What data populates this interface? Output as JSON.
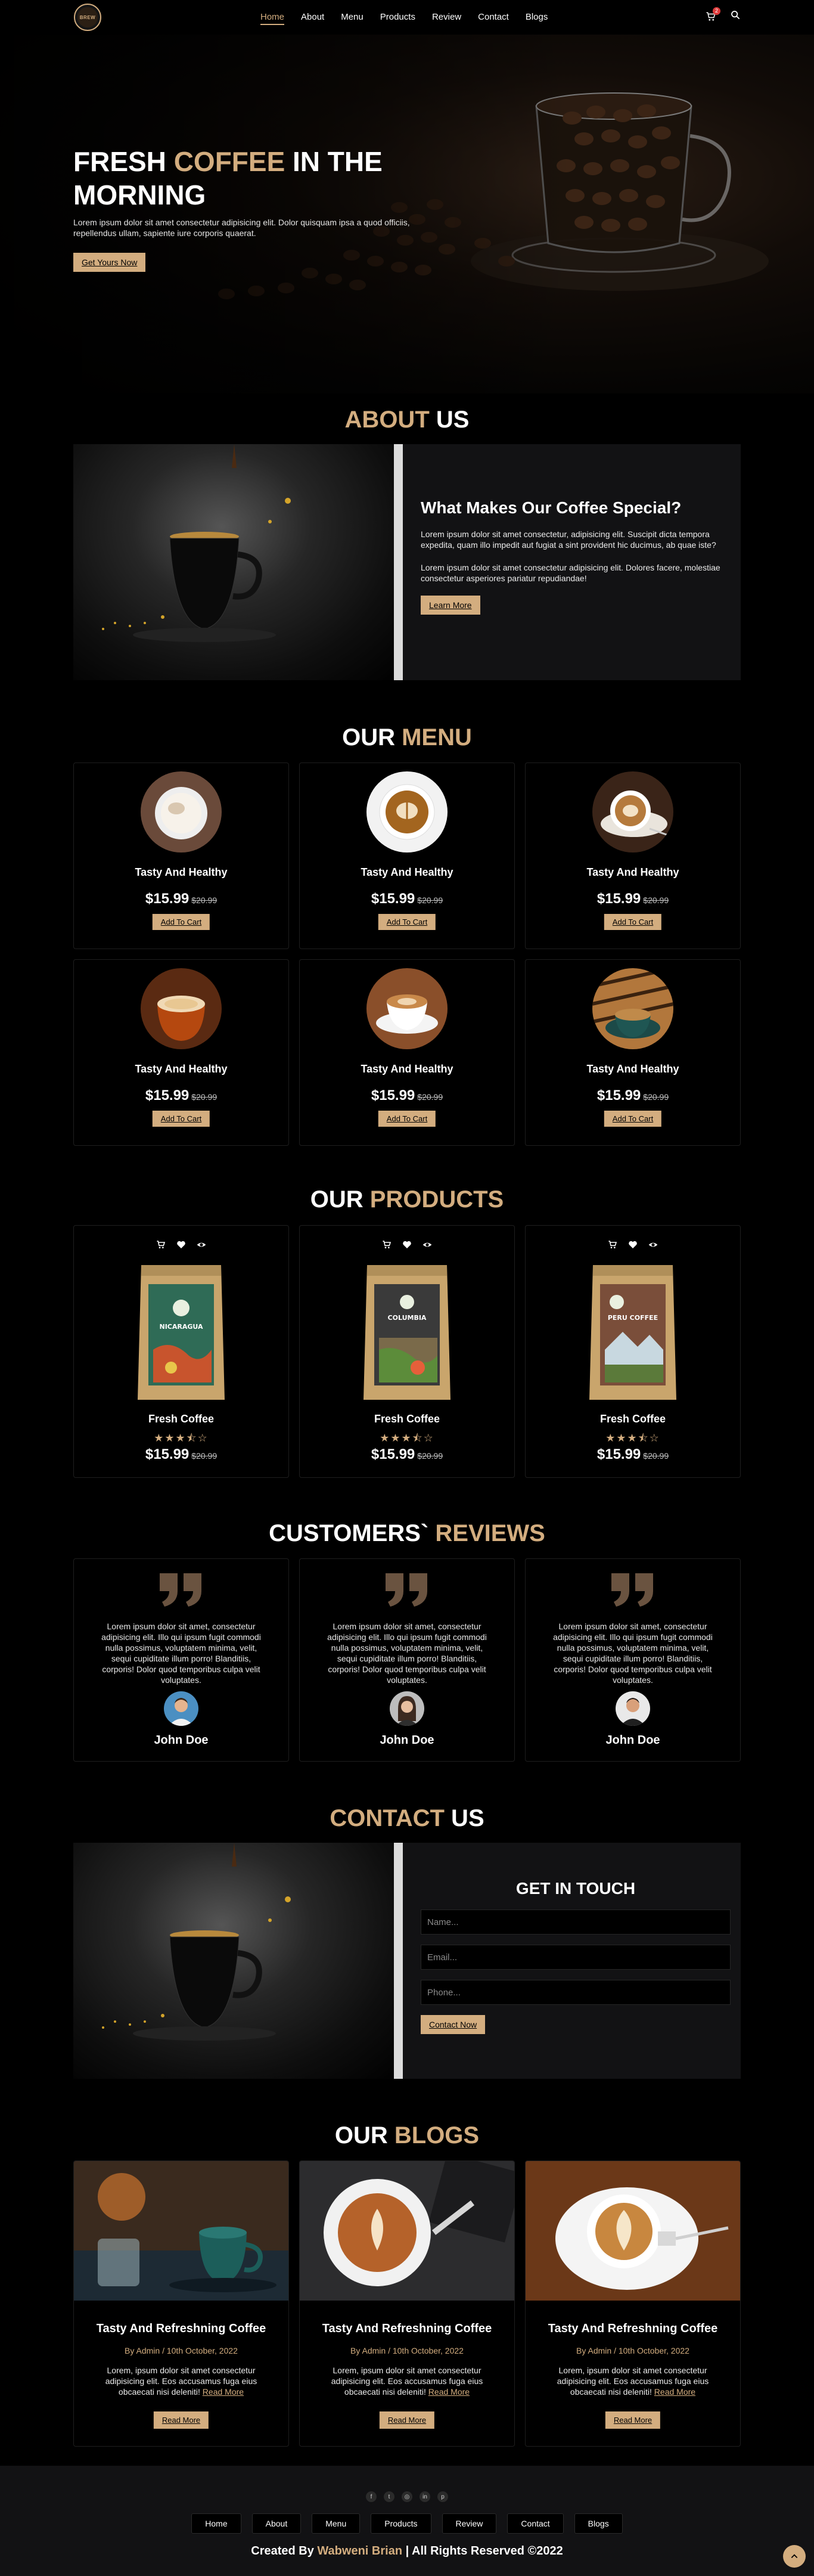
{
  "header": {
    "logo_text": "BREW",
    "nav": [
      "Home",
      "About",
      "Menu",
      "Products",
      "Review",
      "Contact",
      "Blogs"
    ],
    "active_nav": "Home",
    "cart_count": "2"
  },
  "hero": {
    "title_1": "FRESH ",
    "title_accent": "COFFEE",
    "title_2": " IN THE MORNING",
    "text": "Lorem ipsum dolor sit amet consectetur adipisicing elit. Dolor quisquam ipsa a quod officiis, repellendus ullam, sapiente iure corporis quaerat.",
    "button": "Get Yours Now"
  },
  "about": {
    "title_accent": "ABOUT",
    "title_rest": " US",
    "heading": "What Makes Our Coffee Special?",
    "para1": "Lorem ipsum dolor sit amet consectetur, adipisicing elit. Suscipit dicta tempora expedita, quam illo impedit aut fugiat a sint provident hic ducimus, ab quae iste?",
    "para2": "Lorem ipsum dolor sit amet consectetur adipisicing elit. Dolores facere, molestiae consectetur asperiores pariatur repudiandae!",
    "button": "Learn More"
  },
  "menu": {
    "title_main": "OUR ",
    "title_accent": "MENU",
    "items": [
      {
        "name": "Tasty And Healthy",
        "price": "$15.99",
        "old": "$20.99",
        "button": "Add To Cart"
      },
      {
        "name": "Tasty And Healthy",
        "price": "$15.99",
        "old": "$20.99",
        "button": "Add To Cart"
      },
      {
        "name": "Tasty And Healthy",
        "price": "$15.99",
        "old": "$20.99",
        "button": "Add To Cart"
      },
      {
        "name": "Tasty And Healthy",
        "price": "$15.99",
        "old": "$20.99",
        "button": "Add To Cart"
      },
      {
        "name": "Tasty And Healthy",
        "price": "$15.99",
        "old": "$20.99",
        "button": "Add To Cart"
      },
      {
        "name": "Tasty And Healthy",
        "price": "$15.99",
        "old": "$20.99",
        "button": "Add To Cart"
      }
    ]
  },
  "products": {
    "title_main": "OUR ",
    "title_accent": "PRODUCTS",
    "items": [
      {
        "name": "Fresh Coffee",
        "price": "$15.99",
        "old": "$20.99",
        "rating": 3.5,
        "bag_label": "NICARAGUA",
        "bag_color": "#2f6b56"
      },
      {
        "name": "Fresh Coffee",
        "price": "$15.99",
        "old": "$20.99",
        "rating": 3.5,
        "bag_label": "COLUMBIA",
        "bag_color": "#3a3a3a"
      },
      {
        "name": "Fresh Coffee",
        "price": "$15.99",
        "old": "$20.99",
        "rating": 3.5,
        "bag_label": "PERU COFFEE",
        "bag_color": "#7a4e3a"
      }
    ]
  },
  "reviews": {
    "title_main": "CUSTOMERS` ",
    "title_accent": "REVIEWS",
    "items": [
      {
        "text": "Lorem ipsum dolor sit amet, consectetur adipisicing elit. Illo qui ipsum fugit commodi nulla possimus, voluptatem minima, velit, sequi cupiditate illum porro! Blanditiis, corporis! Dolor quod temporibus culpa velit voluptates.",
        "name": "John Doe"
      },
      {
        "text": "Lorem ipsum dolor sit amet, consectetur adipisicing elit. Illo qui ipsum fugit commodi nulla possimus, voluptatem minima, velit, sequi cupiditate illum porro! Blanditiis, corporis! Dolor quod temporibus culpa velit voluptates.",
        "name": "John Doe"
      },
      {
        "text": "Lorem ipsum dolor sit amet, consectetur adipisicing elit. Illo qui ipsum fugit commodi nulla possimus, voluptatem minima, velit, sequi cupiditate illum porro! Blanditiis, corporis! Dolor quod temporibus culpa velit voluptates.",
        "name": "John Doe"
      }
    ]
  },
  "contact": {
    "title_accent": "CONTACT",
    "title_rest": " US",
    "heading": "GET IN TOUCH",
    "name_placeholder": "Name...",
    "email_placeholder": "Email...",
    "phone_placeholder": "Phone...",
    "button": "Contact Now"
  },
  "blogs": {
    "title_main": "OUR ",
    "title_accent": "BLOGS",
    "items": [
      {
        "title": "Tasty And Refreshning Coffee",
        "meta": "By Admin / 10th October, 2022",
        "text": "Lorem, ipsum dolor sit amet consectetur adipisicing elit. Eos accusamus fuga eius obcaecati nisi deleniti! ",
        "read_more": "Read More",
        "button": "Read More"
      },
      {
        "title": "Tasty And Refreshning Coffee",
        "meta": "By Admin / 10th October, 2022",
        "text": "Lorem, ipsum dolor sit amet consectetur adipisicing elit. Eos accusamus fuga eius obcaecati nisi deleniti! ",
        "read_more": "Read More",
        "button": "Read More"
      },
      {
        "title": "Tasty And Refreshning Coffee",
        "meta": "By Admin / 10th October, 2022",
        "text": "Lorem, ipsum dolor sit amet consectetur adipisicing elit. Eos accusamus fuga eius obcaecati nisi deleniti! ",
        "read_more": "Read More",
        "button": "Read More"
      }
    ]
  },
  "footer": {
    "socials": [
      "facebook-icon",
      "twitter-icon",
      "instagram-icon",
      "linkedin-icon",
      "pinterest-icon"
    ],
    "nav": [
      "Home",
      "About",
      "Menu",
      "Products",
      "Review",
      "Contact",
      "Blogs"
    ],
    "credit_pre": "Created By ",
    "credit_name": "Wabweni Brian",
    "credit_post": " | All Rights Reserved ©2022"
  },
  "colors": {
    "accent": "#d3ad7f",
    "background": "#000000",
    "card": "#121214"
  }
}
